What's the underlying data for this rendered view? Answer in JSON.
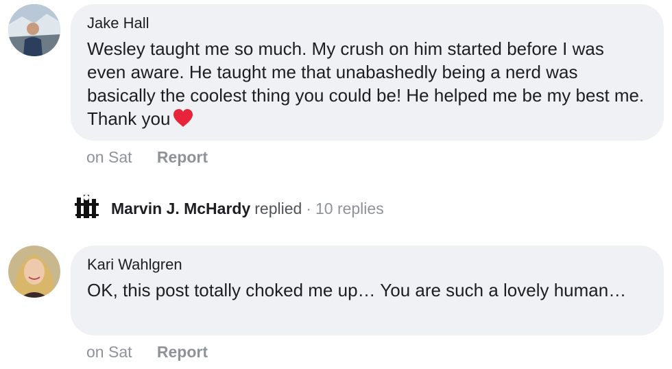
{
  "comments": [
    {
      "author": "Jake Hall",
      "text": "Wesley taught me so much. My crush on him started before I was even aware. He taught me that unabashedly being a nerd was basically the coolest thing you could be! He helped me be my best me. Thank you",
      "emoji": "red-heart",
      "time": "on Sat",
      "report": "Report"
    },
    {
      "author": "Kari Wahlgren",
      "text": "OK, this post totally choked me up… You are such a lovely human…",
      "time": "on Sat",
      "report": "Report"
    }
  ],
  "reply_summary": {
    "name": "Marvin J. McHardy",
    "verb": "replied",
    "separator": "·",
    "count": "10 replies"
  },
  "colors": {
    "bubble": "#eff1f4",
    "meta_text": "#8f9399",
    "heart": "#e8243b"
  }
}
